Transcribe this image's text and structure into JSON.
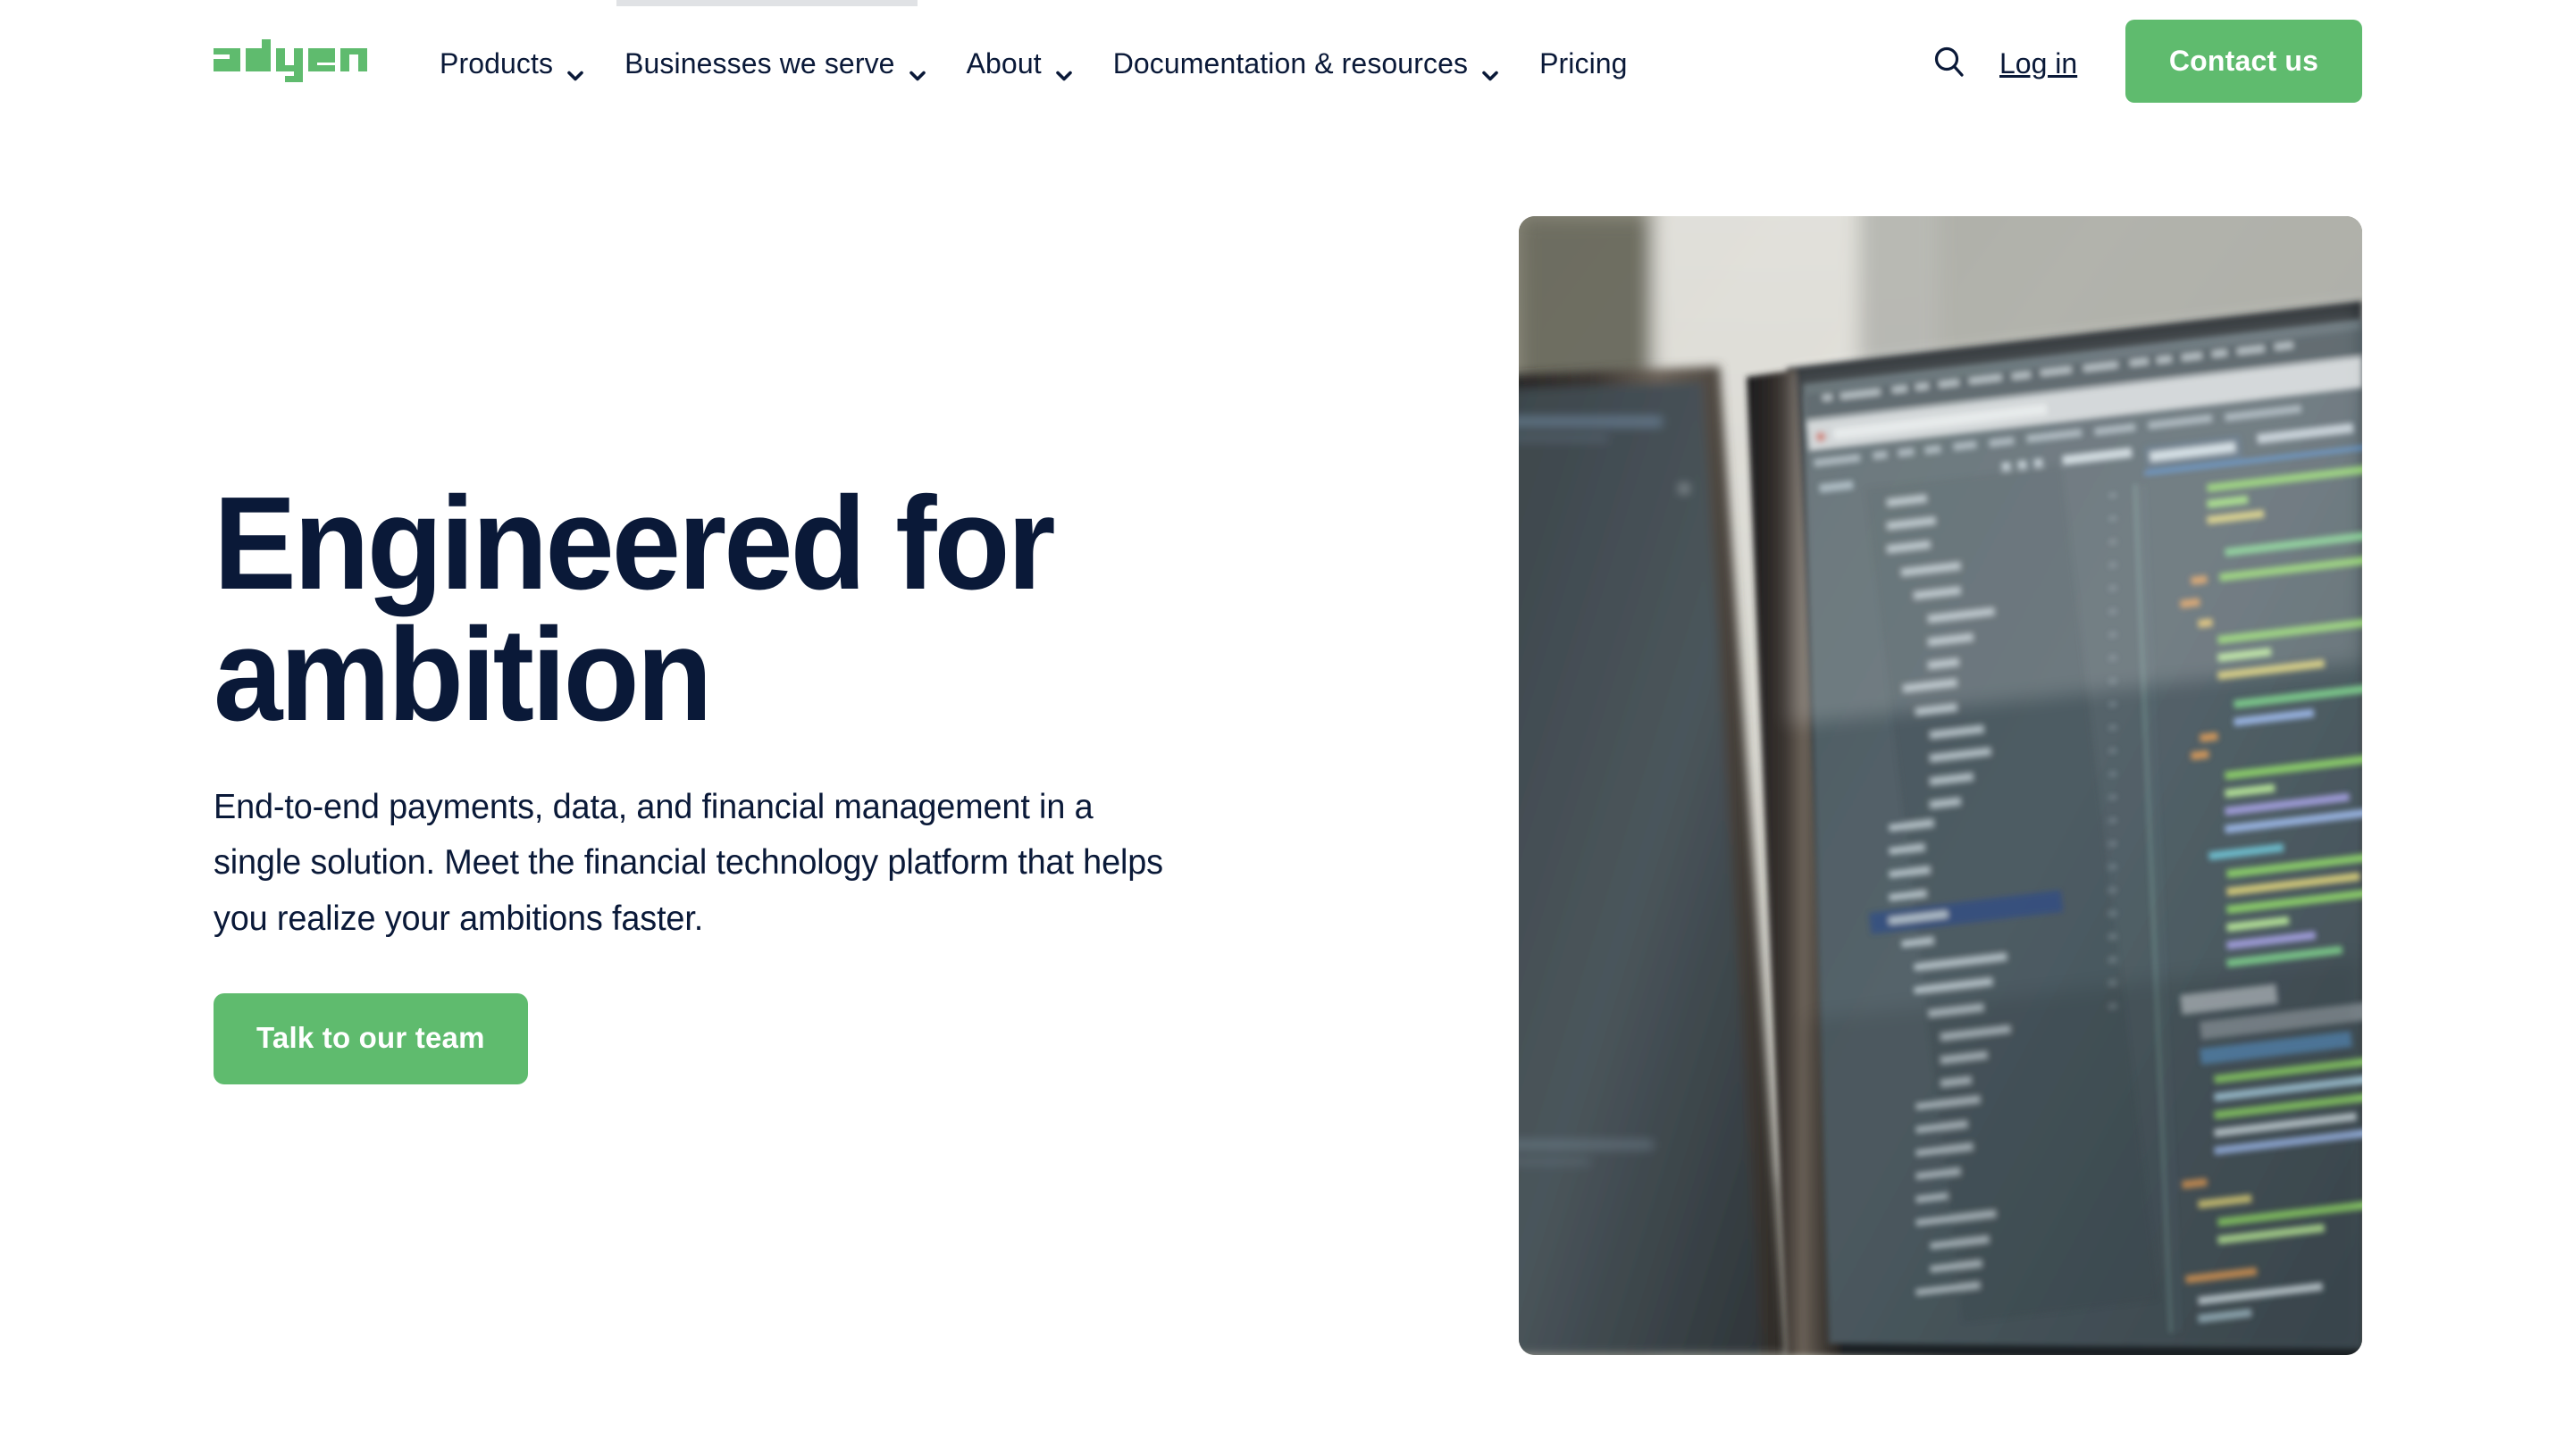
{
  "brand": {
    "name": "adyen",
    "logo_color": "#5fbb6e",
    "text_color": "#0a1938"
  },
  "top_banner": {
    "visible": true,
    "color": "#e0e2e5"
  },
  "header": {
    "logo_label": "adyen",
    "nav": [
      {
        "label": "Products",
        "has_dropdown": true,
        "icon": "chevron-down-icon"
      },
      {
        "label": "Businesses we serve",
        "has_dropdown": true,
        "icon": "chevron-down-icon"
      },
      {
        "label": "About",
        "has_dropdown": true,
        "icon": "chevron-down-icon"
      },
      {
        "label": "Documentation & resources",
        "has_dropdown": true,
        "icon": "chevron-down-icon"
      },
      {
        "label": "Pricing",
        "has_dropdown": false,
        "icon": ""
      }
    ],
    "search_icon": "search-icon",
    "login_label": "Log in",
    "contact_label": "Contact us"
  },
  "hero": {
    "title_line1": "Engineered for",
    "title_line2": "ambition",
    "subtitle": "End-to-end payments, data, and financial management in a single solution. Meet the financial technology platform that helps you realize your ambitions faster.",
    "cta_label": "Talk to our team",
    "image_alt": "Blurred photo of desktop monitors displaying an IDE with a file tree and syntax-highlighted source code"
  }
}
